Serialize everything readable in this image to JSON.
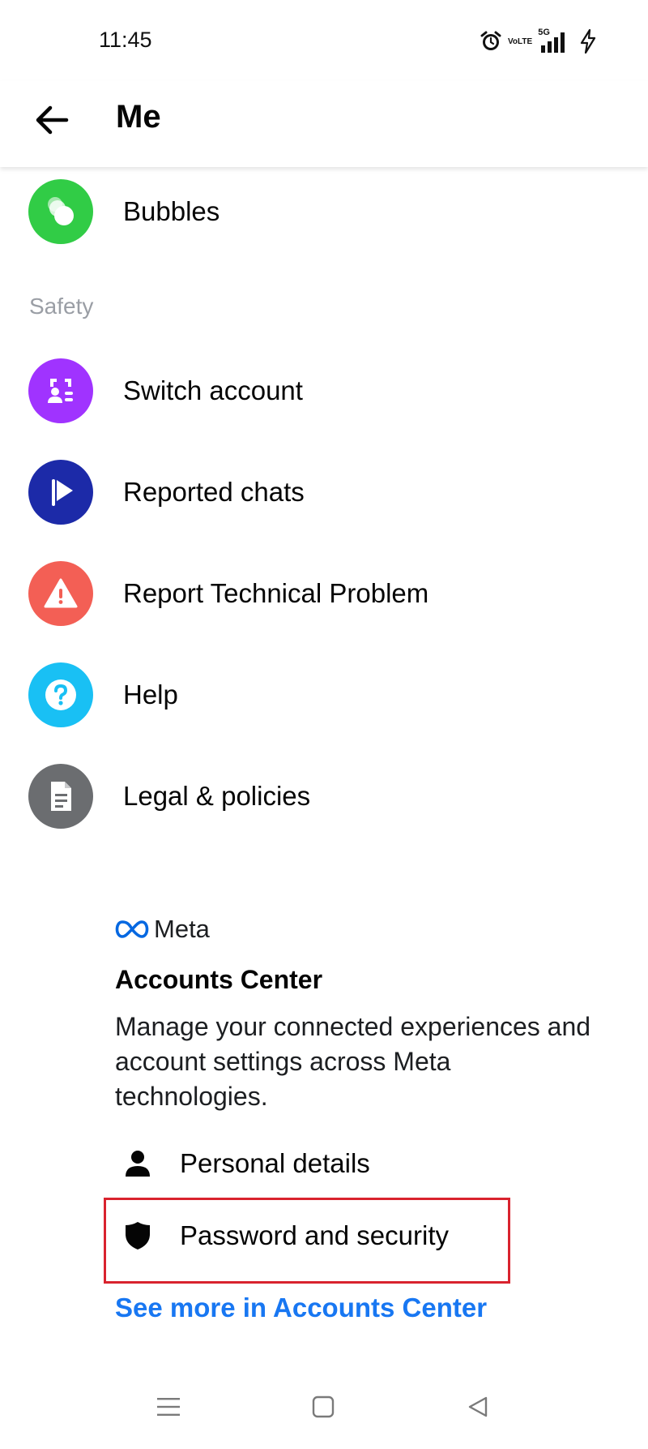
{
  "status_bar": {
    "time": "11:45",
    "volte_top": "Vo",
    "volte_bottom": "LTE",
    "network": "5G",
    "icons": [
      "alarm-icon",
      "volte-icon",
      "signal-5g-icon",
      "charging-icon"
    ]
  },
  "header": {
    "title": "Me",
    "back_icon": "arrow-left-icon"
  },
  "menu": {
    "bubbles": {
      "label": "Bubbles",
      "icon": "bubbles-icon",
      "color": "#31cc46"
    },
    "section_safety": "Safety",
    "items": [
      {
        "label": "Switch account",
        "icon": "switch-account-icon",
        "color": "#a033ff"
      },
      {
        "label": "Reported chats",
        "icon": "flag-icon",
        "color": "#1c2aa8"
      },
      {
        "label": "Report Technical Problem",
        "icon": "warning-icon",
        "color": "#f35f55"
      },
      {
        "label": "Help",
        "icon": "help-icon",
        "color": "#19c0f4"
      },
      {
        "label": "Legal & policies",
        "icon": "document-icon",
        "color": "#6b6d70"
      }
    ]
  },
  "accounts_center": {
    "brand": "Meta",
    "title": "Accounts Center",
    "description": "Manage your connected experiences and account settings across Meta technologies.",
    "rows": [
      {
        "label": "Personal details",
        "icon": "person-icon"
      },
      {
        "label": "Password and security",
        "icon": "shield-icon",
        "highlighted": true
      }
    ],
    "see_more": "See more in Accounts Center",
    "link_color": "#1877f2",
    "highlight_color": "#d9232e"
  },
  "nav_bar": {
    "buttons": [
      "menu-nav-icon",
      "home-nav-icon",
      "back-nav-icon"
    ]
  }
}
